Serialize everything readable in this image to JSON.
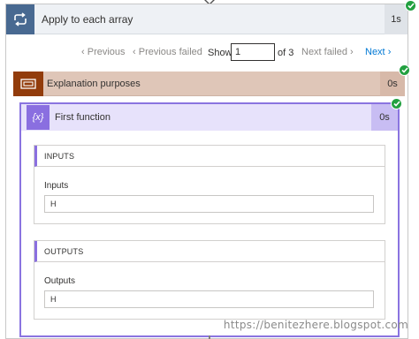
{
  "scope": {
    "title": "Apply to each array",
    "duration": "1s"
  },
  "pager": {
    "previous_label": "Previous",
    "previous_failed_label": "Previous failed",
    "show_label": "Show",
    "current_page": "1",
    "of_label": "of 3",
    "next_failed_label": "Next failed",
    "next_label": "Next"
  },
  "explanation": {
    "title": "Explanation purposes",
    "duration": "0s"
  },
  "first_function": {
    "title": "First function",
    "duration": "0s",
    "icon_glyph": "{x}",
    "inputs_header": "INPUTS",
    "inputs_label": "Inputs",
    "inputs_value": "H",
    "outputs_header": "OUTPUTS",
    "outputs_label": "Outputs",
    "outputs_value": "H"
  },
  "watermark": "https://benitezhere.blogspot.com",
  "colors": {
    "scope_icon": "#486991",
    "explanation_icon": "#923c0b",
    "function_icon": "#8a6fe0",
    "success": "#22a040",
    "link": "#0078d4"
  },
  "icons": {
    "scope": "loop-icon",
    "explanation": "compose-icon",
    "function": "variable-icon",
    "status": "success-check-icon"
  }
}
